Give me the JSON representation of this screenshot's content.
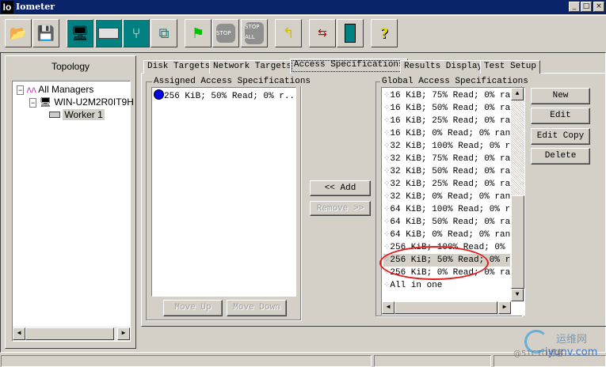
{
  "window": {
    "title": "Iometer",
    "app_icon": "Io",
    "min": "_",
    "max": "□",
    "close": "×"
  },
  "toolbar": [
    "open-icon",
    "save-icon",
    "display-icon",
    "new-disk-worker-icon",
    "new-network-worker-icon",
    "duplicate-worker-icon",
    "start-icon",
    "stop-icon",
    "stop-all-icon",
    "reset-icon",
    "disconnect-icon",
    "exit-icon",
    "help-icon"
  ],
  "topology": {
    "title": "Topology",
    "items": [
      "All Managers",
      "WIN-U2M2R0IT9H",
      "Worker 1"
    ]
  },
  "tabs": [
    "Disk Targets",
    "Network Targets",
    "Access Specifications",
    "Results Display",
    "Test Setup"
  ],
  "assigned": {
    "title": "Assigned Access Specifications",
    "items": [
      "256 KiB; 50% Read; 0% r..."
    ],
    "move_up": "Move Up",
    "move_down": "Move Down"
  },
  "add": "<< Add",
  "remove": "Remove >>",
  "global": {
    "title": "Global Access Specifications",
    "items": [
      "16 KiB; 75% Read; 0% ra.",
      "16 KiB; 50% Read; 0% ra.",
      "16 KiB; 25% Read; 0% ra.",
      "16 KiB; 0% Read; 0% rand",
      "32 KiB; 100% Read; 0% r.",
      "32 KiB; 75% Read; 0% ra.",
      "32 KiB; 50% Read; 0% ra.",
      "32 KiB; 25% Read; 0% ra.",
      "32 KiB; 0% Read; 0% rand",
      "64 KiB; 100% Read; 0% r.",
      "64 KiB; 50% Read; 0% ra.",
      "64 KiB; 0% Read; 0% rand",
      "256 KiB; 100% Read; 0% .",
      "256 KiB; 50% Read; 0% r.",
      "256 KiB; 0% Read; 0% ra.",
      "All in one"
    ],
    "selected_index": 13
  },
  "buttons": {
    "new": "New",
    "edit": "Edit",
    "edit_copy": "Edit Copy",
    "delete": "Delete"
  },
  "watermark": [
    "运维网",
    "iyunv.com",
    "@51CTO博客"
  ],
  "colors": {
    "title_bar": "#0a246a",
    "highlight_ellipse": "#e02020"
  }
}
